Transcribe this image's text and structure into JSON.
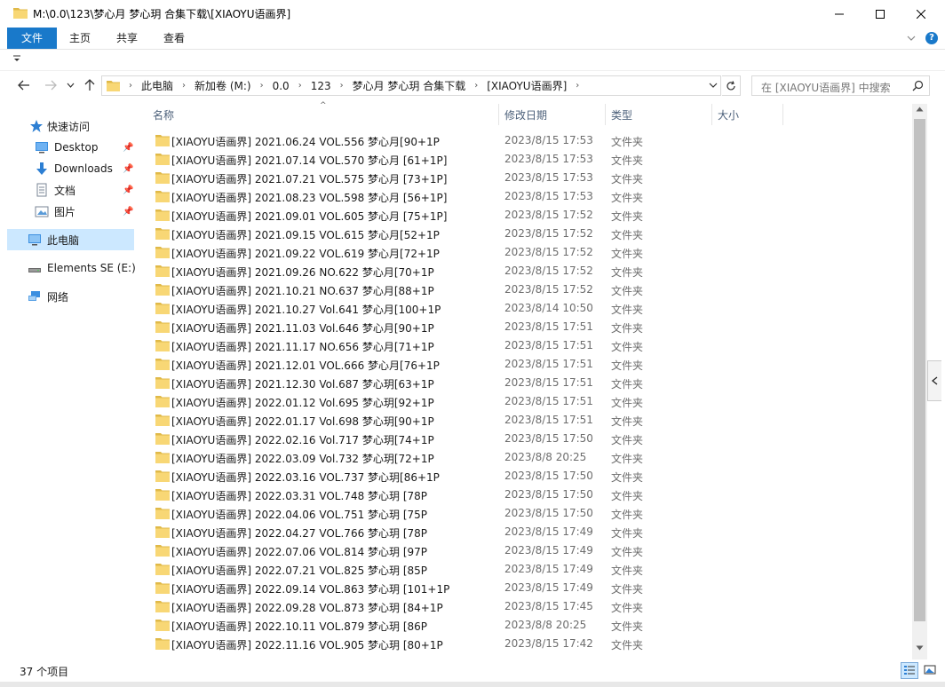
{
  "window": {
    "title": "M:\\0.0\\123\\梦心月 梦心玥 合集下载\\[XIAOYU语画界]",
    "min_icon": "minimize-icon",
    "max_icon": "maximize-icon",
    "close_icon": "close-icon"
  },
  "ribbon": {
    "tabs": [
      "文件",
      "主页",
      "共享",
      "查看"
    ],
    "accent": "#1979ca"
  },
  "address": {
    "crumbs": [
      "此电脑",
      "新加卷 (M:)",
      "0.0",
      "123",
      "梦心月 梦心玥 合集下载",
      "[XIAOYU语画界]"
    ]
  },
  "search": {
    "placeholder": "在 [XIAOYU语画界] 中搜索"
  },
  "navpane": {
    "items": [
      {
        "label": "快速访问",
        "icon": "star-icon"
      },
      {
        "label": "Desktop",
        "icon": "desktop-icon",
        "pinned": true
      },
      {
        "label": "Downloads",
        "icon": "download-icon",
        "pinned": true
      },
      {
        "label": "文档",
        "icon": "document-icon",
        "pinned": true
      },
      {
        "label": "图片",
        "icon": "picture-icon",
        "pinned": true
      },
      {
        "label": "此电脑",
        "icon": "computer-icon",
        "selected": true
      },
      {
        "label": "Elements SE (E:)",
        "icon": "drive-icon"
      },
      {
        "label": "网络",
        "icon": "network-icon"
      }
    ]
  },
  "columns": [
    "名称",
    "修改日期",
    "类型",
    "大小"
  ],
  "files": [
    {
      "name": "[XIAOYU语画界] 2021.06.24 VOL.556 梦心月[90+1P",
      "date": "2023/8/15 17:53",
      "type": "文件夹"
    },
    {
      "name": "[XIAOYU语画界] 2021.07.14 VOL.570 梦心月 [61+1P]",
      "date": "2023/8/15 17:53",
      "type": "文件夹"
    },
    {
      "name": "[XIAOYU语画界] 2021.07.21 VOL.575 梦心月 [73+1P]",
      "date": "2023/8/15 17:53",
      "type": "文件夹"
    },
    {
      "name": "[XIAOYU语画界] 2021.08.23 VOL.598 梦心月 [56+1P]",
      "date": "2023/8/15 17:53",
      "type": "文件夹"
    },
    {
      "name": "[XIAOYU语画界] 2021.09.01 VOL.605 梦心月 [75+1P]",
      "date": "2023/8/15 17:52",
      "type": "文件夹"
    },
    {
      "name": "[XIAOYU语画界] 2021.09.15 VOL.615 梦心月[52+1P",
      "date": "2023/8/15 17:52",
      "type": "文件夹"
    },
    {
      "name": "[XIAOYU语画界] 2021.09.22 VOL.619 梦心月[72+1P",
      "date": "2023/8/15 17:52",
      "type": "文件夹"
    },
    {
      "name": "[XIAOYU语画界] 2021.09.26 NO.622 梦心月[70+1P",
      "date": "2023/8/15 17:52",
      "type": "文件夹"
    },
    {
      "name": "[XIAOYU语画界] 2021.10.21 NO.637 梦心月[88+1P",
      "date": "2023/8/15 17:52",
      "type": "文件夹"
    },
    {
      "name": "[XIAOYU语画界] 2021.10.27 Vol.641 梦心月[100+1P",
      "date": "2023/8/14 10:50",
      "type": "文件夹"
    },
    {
      "name": "[XIAOYU语画界] 2021.11.03 Vol.646 梦心月[90+1P",
      "date": "2023/8/15 17:51",
      "type": "文件夹"
    },
    {
      "name": "[XIAOYU语画界] 2021.11.17 NO.656 梦心月[71+1P",
      "date": "2023/8/15 17:51",
      "type": "文件夹"
    },
    {
      "name": "[XIAOYU语画界] 2021.12.01 VOL.666 梦心月[76+1P",
      "date": "2023/8/15 17:51",
      "type": "文件夹"
    },
    {
      "name": "[XIAOYU语画界] 2021.12.30 Vol.687 梦心玥[63+1P",
      "date": "2023/8/15 17:51",
      "type": "文件夹"
    },
    {
      "name": "[XIAOYU语画界] 2022.01.12 Vol.695 梦心玥[92+1P",
      "date": "2023/8/15 17:51",
      "type": "文件夹"
    },
    {
      "name": "[XIAOYU语画界] 2022.01.17 Vol.698 梦心玥[90+1P",
      "date": "2023/8/15 17:51",
      "type": "文件夹"
    },
    {
      "name": "[XIAOYU语画界] 2022.02.16 Vol.717 梦心玥[74+1P",
      "date": "2023/8/15 17:50",
      "type": "文件夹"
    },
    {
      "name": "[XIAOYU语画界] 2022.03.09 Vol.732 梦心玥[72+1P",
      "date": "2023/8/8 20:25",
      "type": "文件夹"
    },
    {
      "name": "[XIAOYU语画界] 2022.03.16 VOL.737 梦心玥[86+1P",
      "date": "2023/8/15 17:50",
      "type": "文件夹"
    },
    {
      "name": "[XIAOYU语画界] 2022.03.31 VOL.748 梦心玥 [78P",
      "date": "2023/8/15 17:50",
      "type": "文件夹"
    },
    {
      "name": "[XIAOYU语画界] 2022.04.06 VOL.751 梦心玥 [75P",
      "date": "2023/8/15 17:50",
      "type": "文件夹"
    },
    {
      "name": "[XIAOYU语画界] 2022.04.27 VOL.766 梦心玥 [78P",
      "date": "2023/8/15 17:49",
      "type": "文件夹"
    },
    {
      "name": "[XIAOYU语画界] 2022.07.06 VOL.814 梦心玥 [97P",
      "date": "2023/8/15 17:49",
      "type": "文件夹"
    },
    {
      "name": "[XIAOYU语画界] 2022.07.21 VOL.825 梦心玥 [85P",
      "date": "2023/8/15 17:49",
      "type": "文件夹"
    },
    {
      "name": "[XIAOYU语画界] 2022.09.14 VOL.863 梦心玥 [101+1P",
      "date": "2023/8/15 17:49",
      "type": "文件夹"
    },
    {
      "name": "[XIAOYU语画界] 2022.09.28 VOL.873 梦心玥 [84+1P",
      "date": "2023/8/15 17:45",
      "type": "文件夹"
    },
    {
      "name": "[XIAOYU语画界] 2022.10.11 VOL.879 梦心玥 [86P",
      "date": "2023/8/8 20:25",
      "type": "文件夹"
    },
    {
      "name": "[XIAOYU语画界] 2022.11.16 VOL.905 梦心玥  [80+1P",
      "date": "2023/8/15 17:42",
      "type": "文件夹"
    }
  ],
  "status": {
    "count": "37 个项目"
  },
  "colors": {
    "folder": "#f8d775",
    "folder_dark": "#e0b948",
    "selection": "#cce8ff",
    "header_text": "#4c607a"
  }
}
